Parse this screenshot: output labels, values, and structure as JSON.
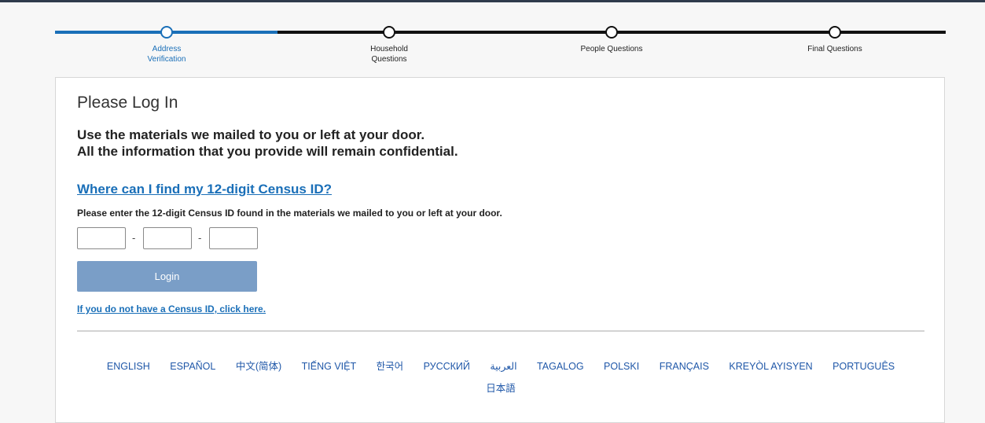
{
  "stepper": {
    "steps": [
      {
        "label_lines": [
          "Address",
          "Verification"
        ],
        "state": "active"
      },
      {
        "label_lines": [
          "Household",
          "Questions"
        ],
        "state": "upcoming"
      },
      {
        "label_lines": [
          "People Questions"
        ],
        "state": "upcoming"
      },
      {
        "label_lines": [
          "Final Questions"
        ],
        "state": "upcoming"
      }
    ]
  },
  "colors": {
    "accent": "#1a6fb8",
    "button_disabled": "#7a9ec7",
    "lang_link": "#1f57a8",
    "track_inactive": "#111111"
  },
  "login": {
    "title": "Please Log In",
    "intro_lines": [
      "Use the materials we mailed to you or left at your door.",
      "All the information that you provide will remain confidential."
    ],
    "help_link": "Where can I find my 12-digit Census ID?",
    "instructions": "Please enter the 12-digit Census ID found in the materials we mailed to you or left at your door.",
    "id_fields": [
      {
        "value": "",
        "placeholder": ""
      },
      {
        "value": "",
        "placeholder": ""
      },
      {
        "value": "",
        "placeholder": ""
      }
    ],
    "separator": "-",
    "login_label": "Login",
    "no_id_link": "If you do not have a Census ID, click here."
  },
  "languages": [
    "ENGLISH",
    "ESPAÑOL",
    "中文(简体)",
    "TIẾNG VIỆT",
    "한국어",
    "РУССКИЙ",
    "العربية",
    "TAGALOG",
    "POLSKI",
    "FRANÇAIS",
    "KREYÒL AYISYEN",
    "PORTUGUÊS",
    "日本語"
  ]
}
